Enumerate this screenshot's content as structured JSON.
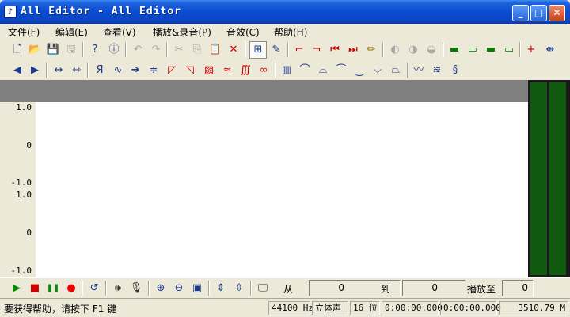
{
  "window": {
    "title": "All Editor - All Editor",
    "minimize_glyph": "_",
    "maximize_glyph": "□",
    "close_glyph": "✕",
    "app_icon_glyph": "♪"
  },
  "menu": {
    "items": [
      "文件(F)",
      "编辑(E)",
      "查看(V)",
      "播放&录音(P)",
      "音效(C)",
      "帮助(H)"
    ]
  },
  "toolbar1": {
    "icons": [
      {
        "name": "new-file-icon",
        "glyph": "🗋"
      },
      {
        "name": "open-folder-icon",
        "glyph": "📂"
      },
      {
        "name": "save-icon",
        "glyph": "💾"
      },
      {
        "name": "save-all-icon",
        "glyph": "🖫"
      },
      {
        "name": "help-icon",
        "glyph": "?"
      },
      {
        "name": "info-icon",
        "glyph": "ⓘ"
      },
      {
        "name": "undo-icon",
        "glyph": "↶"
      },
      {
        "name": "redo-icon",
        "glyph": "↷"
      },
      {
        "name": "cut-icon",
        "glyph": "✂"
      },
      {
        "name": "copy-icon",
        "glyph": "⎘"
      },
      {
        "name": "paste-icon",
        "glyph": "📋"
      },
      {
        "name": "delete-icon",
        "glyph": "✕"
      },
      {
        "name": "select-mode-icon",
        "glyph": "⊞"
      },
      {
        "name": "draw-mode-icon",
        "glyph": "✎"
      },
      {
        "name": "crop-icon",
        "glyph": "⌐"
      },
      {
        "name": "trim-icon",
        "glyph": "¬"
      },
      {
        "name": "jump-start-icon",
        "glyph": "⏮"
      },
      {
        "name": "jump-end-icon",
        "glyph": "⏭"
      },
      {
        "name": "pencil-icon",
        "glyph": "✏"
      },
      {
        "name": "mark-left-icon",
        "glyph": "◐"
      },
      {
        "name": "mark-both-icon",
        "glyph": "◑"
      },
      {
        "name": "mark-right-icon",
        "glyph": "◒"
      },
      {
        "name": "insert-track-icon",
        "glyph": "▬"
      },
      {
        "name": "insert-track-down-icon",
        "glyph": "▭"
      },
      {
        "name": "merge-track-icon",
        "glyph": "▬"
      },
      {
        "name": "split-track-icon",
        "glyph": "▭"
      },
      {
        "name": "split-marker-icon",
        "glyph": "+"
      },
      {
        "name": "join-marker-icon",
        "glyph": "⇹"
      }
    ]
  },
  "toolbar2": {
    "icons": [
      {
        "name": "wave-shrink-icon",
        "glyph": "◀"
      },
      {
        "name": "wave-expand-icon",
        "glyph": "▶"
      },
      {
        "name": "stretch-icon",
        "glyph": "↔"
      },
      {
        "name": "compress-icon",
        "glyph": "⇿"
      },
      {
        "name": "reverse-icon",
        "glyph": "Я"
      },
      {
        "name": "invert-icon",
        "glyph": "∿"
      },
      {
        "name": "amplify-icon",
        "glyph": "➔"
      },
      {
        "name": "normalize-icon",
        "glyph": "≑"
      },
      {
        "name": "fade-in-icon",
        "glyph": "◸"
      },
      {
        "name": "fade-out-icon",
        "glyph": "◹"
      },
      {
        "name": "silence-icon",
        "glyph": "▨"
      },
      {
        "name": "noise-icon",
        "glyph": "≈"
      },
      {
        "name": "echo-icon",
        "glyph": "∭"
      },
      {
        "name": "chorus-icon",
        "glyph": "∞"
      },
      {
        "name": "equalizer-icon",
        "glyph": "▥"
      },
      {
        "name": "low-pass-icon",
        "glyph": "⌒"
      },
      {
        "name": "high-pass-icon",
        "glyph": "⌓"
      },
      {
        "name": "band-pass-icon",
        "glyph": "⏜"
      },
      {
        "name": "band-stop-icon",
        "glyph": "⏝"
      },
      {
        "name": "notch-icon",
        "glyph": "⌵"
      },
      {
        "name": "filter-icon",
        "glyph": "⏢"
      },
      {
        "name": "vibrato-icon",
        "glyph": "〰"
      },
      {
        "name": "flanger-icon",
        "glyph": "≋"
      },
      {
        "name": "spiral-icon",
        "glyph": "§"
      }
    ]
  },
  "waveform": {
    "channel1_labels": [
      "1.0",
      "0",
      "-1.0"
    ],
    "channel2_labels": [
      "1.0",
      "0",
      "-1.0"
    ]
  },
  "transport": {
    "icons": [
      {
        "name": "play-icon",
        "glyph": "▶",
        "color": "#0a8a0a"
      },
      {
        "name": "stop-icon",
        "glyph": "■",
        "color": "#cc0000"
      },
      {
        "name": "pause-icon",
        "glyph": "❚❚",
        "color": "#0a8a0a"
      },
      {
        "name": "record-icon",
        "glyph": "●",
        "color": "#ee0000"
      },
      {
        "name": "loop-icon",
        "glyph": "↺",
        "color": "#1b3b8c"
      },
      {
        "name": "volume-icon",
        "glyph": "🕪",
        "color": "#333333"
      },
      {
        "name": "microphone-icon",
        "glyph": "🎙",
        "color": "#333333"
      },
      {
        "name": "zoom-in-icon",
        "glyph": "⊕",
        "color": "#1b3b8c"
      },
      {
        "name": "zoom-out-icon",
        "glyph": "⊖",
        "color": "#1b3b8c"
      },
      {
        "name": "zoom-fit-icon",
        "glyph": "▣",
        "color": "#1b3b8c"
      },
      {
        "name": "zoom-vertical-in-icon",
        "glyph": "⇕",
        "color": "#1b3b8c"
      },
      {
        "name": "zoom-vertical-out-icon",
        "glyph": "⇳",
        "color": "#1b3b8c"
      },
      {
        "name": "monitor-icon",
        "glyph": "🖵",
        "color": "#333333"
      }
    ],
    "from_label": "从",
    "from_value": "0",
    "to_label": "到",
    "to_value": "0",
    "play_to_label": "播放至",
    "play_to_value": "0"
  },
  "status": {
    "help_text": "要获得帮助，请按下 F1 键",
    "sample_rate": "44100 Hz",
    "channels": "立体声",
    "bit_depth": "16 位",
    "time_start": "0:00:00.000",
    "time_end": "0:00:00.000",
    "memory": "3510.79 M"
  },
  "colors": {
    "titlebar": "#0a4cd1",
    "meter": "#0f5a0f",
    "waveform_header": "#808080"
  }
}
